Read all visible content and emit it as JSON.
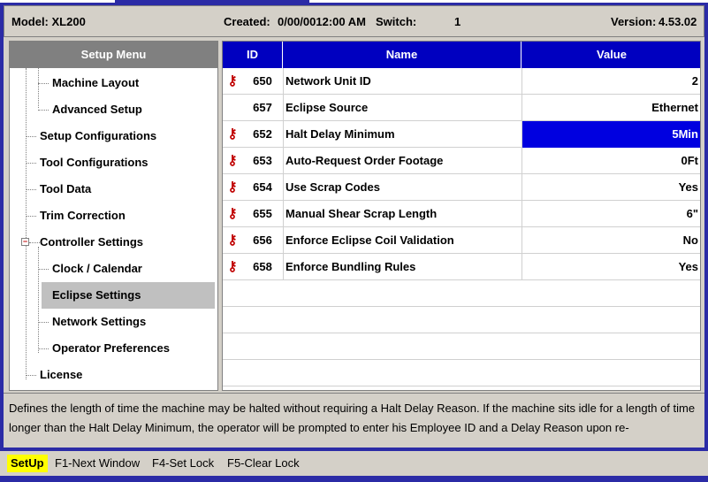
{
  "header": {
    "model": "Model: XL200",
    "created_label": "Created:",
    "created_value": "0/00/0012:00 AM",
    "switch_label": "Switch:",
    "switch_value": "1",
    "version_label": "Version:",
    "version_value": "4.53.02"
  },
  "sidebar": {
    "title": "Setup Menu",
    "items": [
      {
        "label": "Machine Layout"
      },
      {
        "label": "Advanced Setup"
      },
      {
        "label": "Setup Configurations"
      },
      {
        "label": "Tool Configurations"
      },
      {
        "label": "Tool Data"
      },
      {
        "label": "Trim Correction"
      },
      {
        "label": "Controller Settings",
        "expander": "−"
      },
      {
        "label": "Clock / Calendar"
      },
      {
        "label": "Eclipse Settings",
        "selected": true
      },
      {
        "label": "Network Settings"
      },
      {
        "label": "Operator Preferences"
      },
      {
        "label": "License"
      }
    ]
  },
  "grid": {
    "columns": [
      "ID",
      "Name",
      "Value"
    ],
    "rows": [
      {
        "lock": true,
        "id": "650",
        "name": "Network Unit ID",
        "value": "2"
      },
      {
        "lock": false,
        "id": "657",
        "name": "Eclipse Source",
        "value": "Ethernet"
      },
      {
        "lock": true,
        "id": "652",
        "name": "Halt Delay Minimum",
        "value": "5Min",
        "selected": true
      },
      {
        "lock": true,
        "id": "653",
        "name": "Auto-Request Order Footage",
        "value": "0Ft"
      },
      {
        "lock": true,
        "id": "654",
        "name": "Use Scrap Codes",
        "value": "Yes"
      },
      {
        "lock": true,
        "id": "655",
        "name": "Manual Shear Scrap Length",
        "value": "6\""
      },
      {
        "lock": true,
        "id": "656",
        "name": "Enforce Eclipse Coil Validation",
        "value": "No"
      },
      {
        "lock": true,
        "id": "658",
        "name": "Enforce Bundling Rules",
        "value": "Yes"
      }
    ],
    "lock_icon": "key-icon"
  },
  "description": "Defines the length of time the machine may be halted without requiring a Halt Delay Reason. If the machine sits idle for a length of time longer than the Halt Delay Minimum, the operator will be prompted to enter his Employee ID and a Delay Reason upon re-",
  "function_bar": {
    "mode": "SetUp",
    "keys": [
      "F1-Next Window",
      "F4-Set Lock",
      "F5-Clear Lock"
    ]
  },
  "colors": {
    "frame": "#2b2ba6",
    "panel": "#d4d0c8",
    "header_blue": "#0000c0",
    "selection_blue": "#0000e0",
    "mode_yellow": "#ffff00",
    "lock_red": "#c00000"
  }
}
